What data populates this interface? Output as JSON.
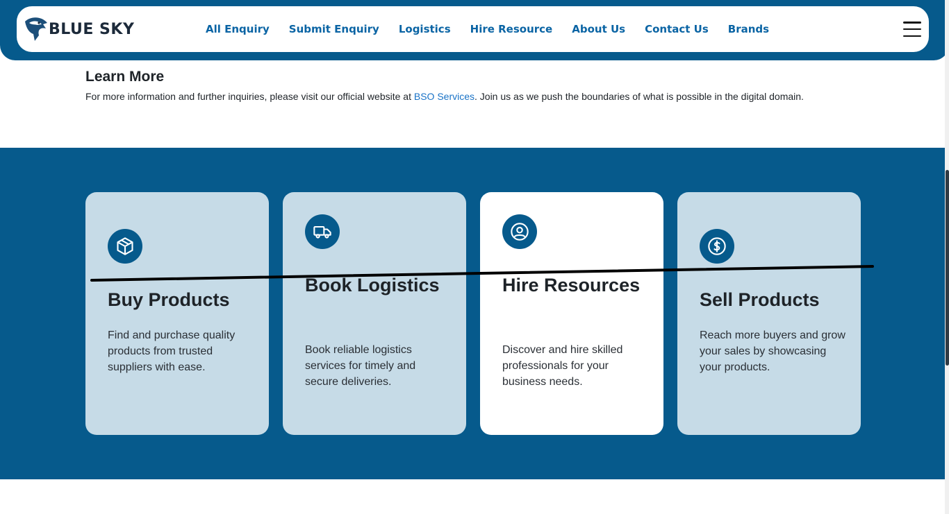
{
  "brand": {
    "name": "BLUE SKY",
    "colors": {
      "primary": "#065a8c",
      "link": "#0a64a4",
      "card": "#c6dbe7"
    }
  },
  "nav": {
    "items": [
      "All Enquiry",
      "Submit Enquiry",
      "Logistics",
      "Hire Resource",
      "About Us",
      "Contact Us",
      "Brands"
    ],
    "menu_icon": "hamburger-icon"
  },
  "learn_more": {
    "heading": "Learn More",
    "text_before": "For more information and further inquiries, please visit our official website at ",
    "link_text": "BSO Services",
    "text_after": ". Join us as we push the boundaries of what is possible in the digital domain."
  },
  "cards": [
    {
      "title": "Buy Products",
      "description": "Find and purchase quality products from trusted suppliers with ease.",
      "icon": "box-icon",
      "highlighted": false
    },
    {
      "title": "Book Logistics",
      "description": "Book reliable logistics services for timely and secure deliveries.",
      "icon": "truck-icon",
      "highlighted": false
    },
    {
      "title": "Hire Resources",
      "description": "Discover and hire skilled professionals for your business needs.",
      "icon": "user-circle-icon",
      "highlighted": true
    },
    {
      "title": "Sell Products",
      "description": "Reach more buyers and grow your sales by showcasing your products.",
      "icon": "dollar-icon",
      "highlighted": false
    }
  ]
}
